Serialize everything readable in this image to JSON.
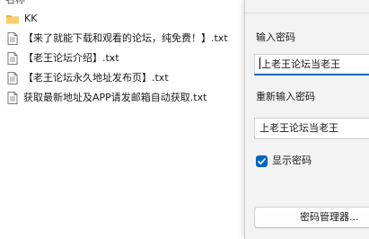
{
  "file_pane": {
    "column_header": "名称",
    "items": [
      {
        "type": "folder",
        "icon": "folder-icon",
        "name": "KK"
      },
      {
        "type": "file",
        "icon": "text-file-icon",
        "name": "【来了就能下载和观看的论坛，纯免费！】.txt"
      },
      {
        "type": "file",
        "icon": "text-file-icon",
        "name": "【老王论坛介绍】.txt"
      },
      {
        "type": "file",
        "icon": "text-file-icon",
        "name": "【老王论坛永久地址发布页】.txt"
      },
      {
        "type": "file",
        "icon": "text-file-icon",
        "name": "获取最新地址及APP请发邮箱自动获取.txt"
      }
    ]
  },
  "dialog": {
    "password_label": "输入密码",
    "password_value": "上老王论坛当老王",
    "confirm_label": "重新输入密码",
    "confirm_value": "上老王论坛当老王",
    "show_password_label": "显示密码",
    "show_password_checked": true,
    "manager_button_label": "密码管理器..."
  },
  "colors": {
    "accent": "#0067c0",
    "folder": "#f2c94c",
    "dialog_bg": "#f3f3f3"
  }
}
